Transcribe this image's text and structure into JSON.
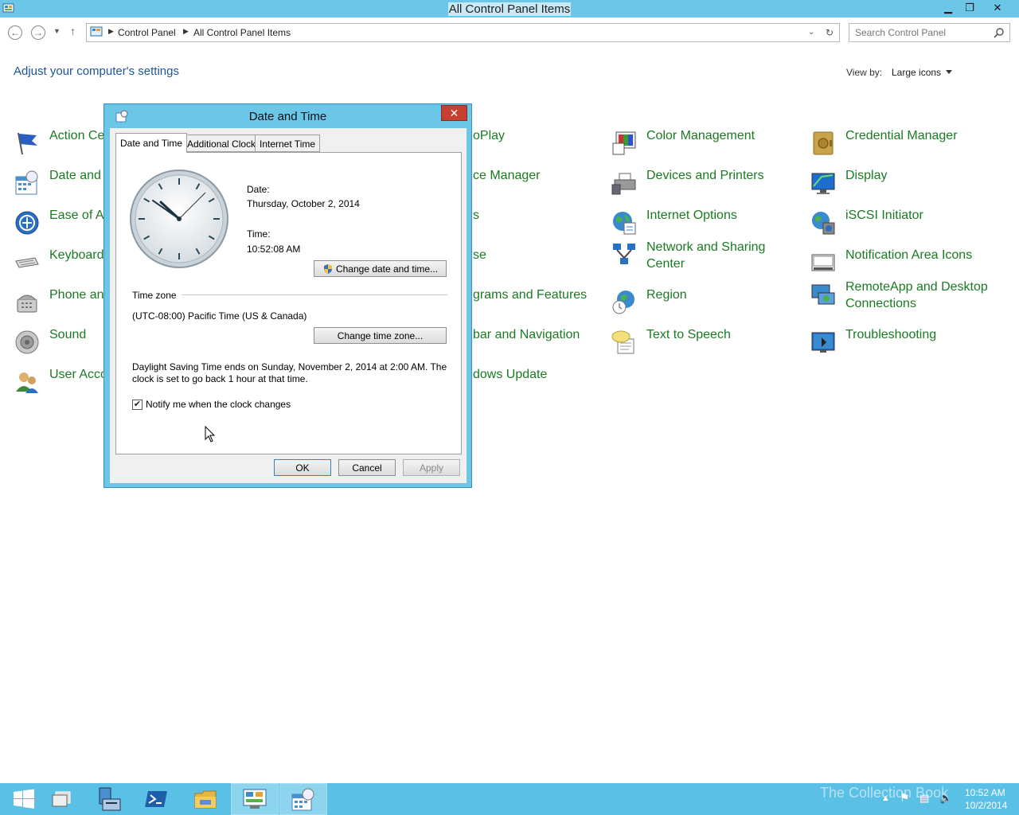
{
  "window": {
    "title": "All Control Panel Items",
    "minimize": "▁",
    "restore": "❐",
    "close": "✕"
  },
  "address_bar": {
    "crumbs": [
      "Control Panel",
      "All Control Panel Items"
    ],
    "search_placeholder": "Search Control Panel"
  },
  "content": {
    "heading": "Adjust your computer's settings",
    "view_by_label": "View by:",
    "view_by_value": "Large icons"
  },
  "items": {
    "col1": [
      "Action Ce",
      "Date and T",
      "Ease of Ac",
      "Keyboard",
      "Phone anc",
      "Sound",
      "User Acco"
    ],
    "col2": [
      "oPlay",
      "ce Manager",
      "s",
      "se",
      "grams and Features",
      "bar and Navigation",
      "dows Update"
    ],
    "col3": [
      "Color Management",
      "Devices and Printers",
      "Internet Options",
      "Network and Sharing Center",
      "Region",
      "Text to Speech"
    ],
    "col4": [
      "Credential Manager",
      "Display",
      "iSCSI Initiator",
      "Notification Area Icons",
      "RemoteApp and Desktop Connections",
      "Troubleshooting"
    ]
  },
  "dialog": {
    "title": "Date and Time",
    "close": "✕",
    "tabs": [
      "Date and Time",
      "Additional Clocks",
      "Internet Time"
    ],
    "date_label": "Date:",
    "date_value": "Thursday, October 2, 2014",
    "time_label": "Time:",
    "time_value": "10:52:08 AM",
    "change_datetime_button": "Change date and time...",
    "timezone_header": "Time zone",
    "timezone_value": "(UTC-08:00) Pacific Time (US & Canada)",
    "change_timezone_button": "Change time zone...",
    "dst_line1": "Daylight Saving Time ends on Sunday, November 2, 2014 at 2:00 AM. The",
    "dst_line2": "clock is set to go back 1 hour at that time.",
    "notify_label": "Notify me when the clock changes",
    "notify_checked": true,
    "ok_button": "OK",
    "cancel_button": "Cancel",
    "apply_button": "Apply"
  },
  "taskbar": {
    "time": "10:52 AM",
    "date": "10/2/2014",
    "watermark": "The Collection Book"
  },
  "colors": {
    "chrome": "#6bc6e8",
    "taskbar": "#5bc0e6",
    "link_green": "#1a7a22",
    "heading_blue": "#1e5499"
  }
}
